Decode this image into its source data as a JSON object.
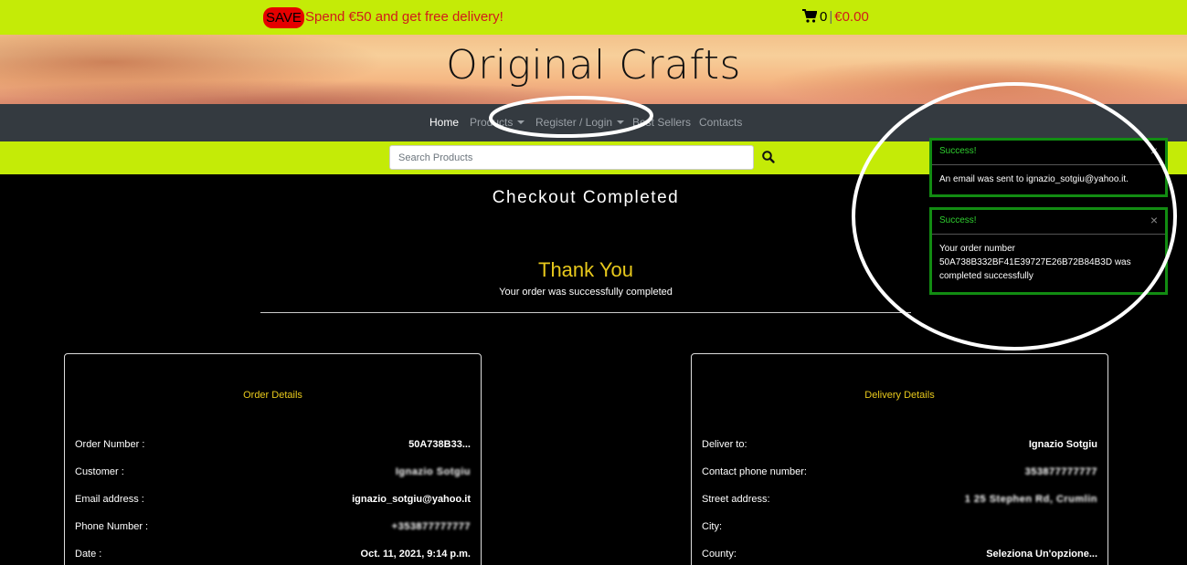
{
  "promo": {
    "badge": "SAVE",
    "text": "Spend €50 and get free delivery!"
  },
  "cart": {
    "count": "0",
    "separator": "|",
    "total": "€0.00",
    "icon": "cart-icon"
  },
  "site": {
    "title": "Original Crafts"
  },
  "nav": {
    "home": "Home",
    "products": "Products",
    "register_login": "Register / Login",
    "best_sellers": "Best Sellers",
    "contacts": "Contacts"
  },
  "search": {
    "placeholder": "Search Products",
    "icon": "search-icon"
  },
  "checkout": {
    "title": "Checkout Completed",
    "thank_you": "Thank You",
    "subtitle": "Your order was successfully completed"
  },
  "order_details": {
    "title": "Order Details",
    "rows": [
      {
        "label": "Order Number :",
        "value": "50A738B33..."
      },
      {
        "label": "Customer :",
        "value": "Ignazio Sotgiu"
      },
      {
        "label": "Email address :",
        "value": "ignazio_sotgiu@yahoo.it"
      },
      {
        "label": "Phone Number :",
        "value": "+353877777777"
      },
      {
        "label": "Date :",
        "value": "Oct. 11, 2021, 9:14 p.m."
      }
    ]
  },
  "delivery_details": {
    "title": "Delivery Details",
    "rows": [
      {
        "label": "Deliver to:",
        "value": "Ignazio Sotgiu"
      },
      {
        "label": "Contact phone number:",
        "value": "353877777777"
      },
      {
        "label": "Street address:",
        "value": "1 25 Stephen Rd, Crumlin"
      },
      {
        "label": "City:",
        "value": ""
      },
      {
        "label": "County:",
        "value": "Seleziona Un'opzione..."
      }
    ]
  },
  "toasts": [
    {
      "title": "Success!",
      "message": "An email was sent to ignazio_sotgiu@yahoo.it.",
      "close": "×"
    },
    {
      "title": "Success!",
      "message": "Your order number 50A738B332BF41E39727E26B72B84B3D was completed successfully",
      "close": "×"
    }
  ],
  "colors": {
    "lime": "#c4eb07",
    "promo_red": "#d11b1b",
    "nav_bg": "#343a40",
    "gold": "#e8c91c",
    "success_green": "#128c12"
  }
}
